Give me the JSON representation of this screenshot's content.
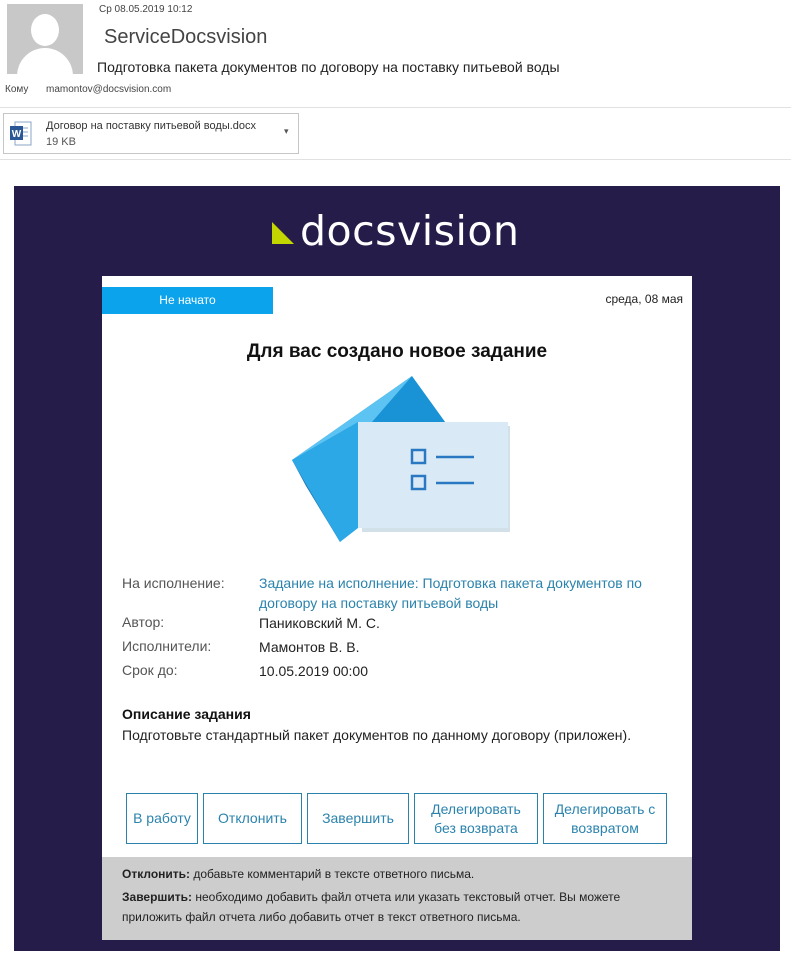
{
  "header": {
    "date": "Ср 08.05.2019 10:12",
    "sender": "ServiceDocsvision",
    "subject": "Подготовка пакета документов по договору на поставку питьевой воды",
    "to_label": "Кому",
    "to_value": "mamontov@docsvision.com"
  },
  "attachment": {
    "file_name": "Договор на поставку питьевой воды.docx",
    "file_size": "19 KB",
    "icon": "word-doc-icon"
  },
  "email": {
    "logo_text": "docsvision",
    "status": "Не начато",
    "date": "среда, 08 мая",
    "title": "Для вас создано новое задание",
    "fields": {
      "task_label": "На исполнение:",
      "task_value": "Задание на исполнение: Подготовка пакета документов по договору на поставку питьевой воды",
      "author_label": "Автор:",
      "author_value": "Паниковский М. С.",
      "performers_label": "Исполнители:",
      "performers_value": "Мамонтов В. В.",
      "deadline_label": "Срок до:",
      "deadline_value": "10.05.2019 00:00"
    },
    "description_title": "Описание задания",
    "description_text": "Подготовьте стандартный пакет документов по данному договору (приложен).",
    "buttons": {
      "in_work": "В работу",
      "reject": "Отклонить",
      "complete": "Завершить",
      "delegate_no_return": "Делегировать без возврата",
      "delegate_with_return": "Делегировать с возвратом"
    },
    "notes": {
      "reject_bold": "Отклонить:",
      "reject_text": " добавьте комментарий в тексте ответного письма.",
      "complete_bold": "Завершить:",
      "complete_text": " необходимо добавить файл отчета или указать текстовый отчет. Вы можете приложить файл отчета либо добавить отчет в текст ответного письма."
    }
  },
  "colors": {
    "banner_bg": "#261c4a",
    "status_blue": "#0ba3ec",
    "link_blue": "#2b83ad",
    "logo_mark": "#c4d600",
    "footer_gray": "#cdcdcd"
  }
}
